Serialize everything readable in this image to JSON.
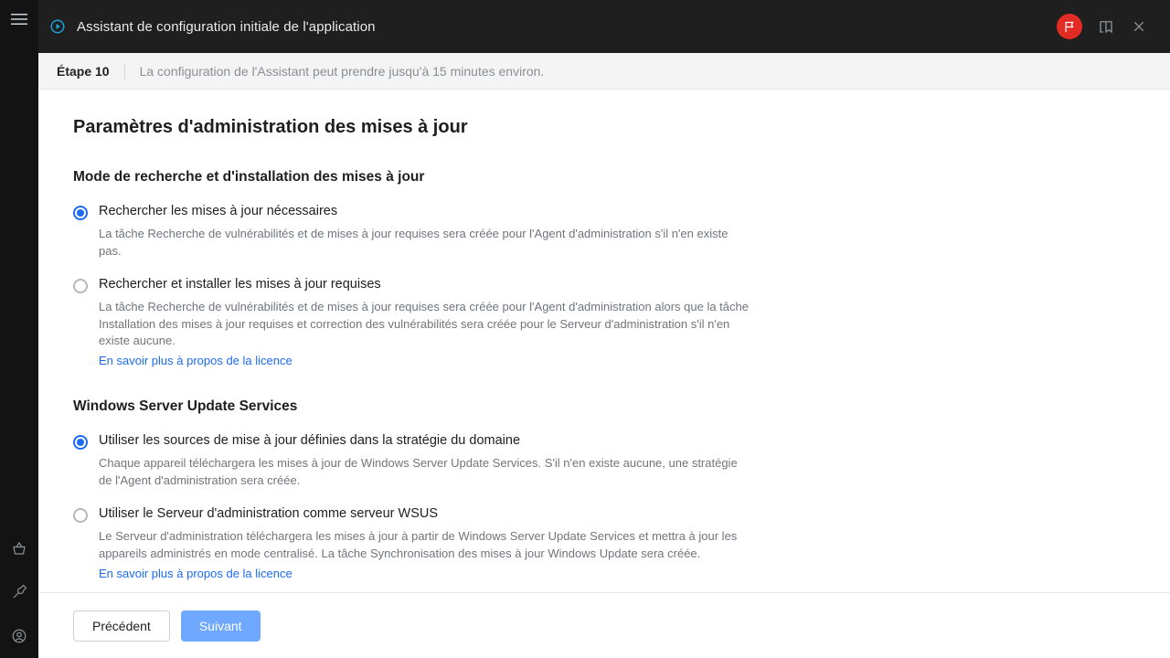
{
  "header": {
    "title": "Assistant de configuration initiale de l'application"
  },
  "stepbar": {
    "step": "Étape 10",
    "description": "La configuration de l'Assistant peut prendre jusqu'à 15 minutes environ."
  },
  "page": {
    "title": "Paramètres d'administration des mises à jour",
    "section1": {
      "heading": "Mode de recherche et d'installation des mises à jour",
      "options": [
        {
          "label": "Rechercher les mises à jour nécessaires",
          "desc": "La tâche Recherche de vulnérabilités et de mises à jour requises sera créée pour l'Agent d'administration s'il n'en existe pas.",
          "selected": true
        },
        {
          "label": "Rechercher et installer les mises à jour requises",
          "desc": "La tâche Recherche de vulnérabilités et de mises à jour requises sera créée pour l'Agent d'administration alors que la tâche Installation des mises à jour requises et correction des vulnérabilités sera créée pour le Serveur d'administration s'il n'en existe aucune.",
          "link": "En savoir plus à propos de la licence",
          "selected": false
        }
      ]
    },
    "section2": {
      "heading": "Windows Server Update Services",
      "options": [
        {
          "label": "Utiliser les sources de mise à jour définies dans la stratégie du domaine",
          "desc": "Chaque appareil téléchargera les mises à jour de Windows Server Update Services. S'il n'en existe aucune, une stratégie de l'Agent d'administration sera créée.",
          "selected": true
        },
        {
          "label": "Utiliser le Serveur d'administration comme serveur WSUS",
          "desc": "Le Serveur d'administration téléchargera les mises à jour à partir de Windows Server Update Services et mettra à jour les appareils administrés en mode centralisé. La tâche Synchronisation des mises à jour Windows Update sera créée.",
          "link": "En savoir plus à propos de la licence",
          "selected": false
        }
      ]
    }
  },
  "footer": {
    "prev": "Précédent",
    "next": "Suivant"
  }
}
